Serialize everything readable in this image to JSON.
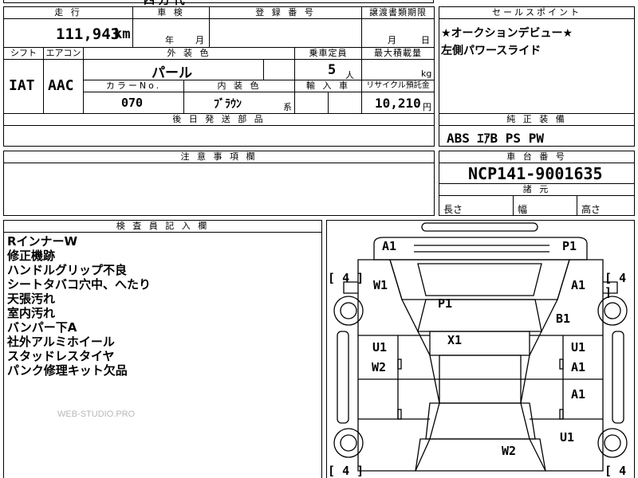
{
  "sheet": {
    "top_partial_text": "四 万 代",
    "mileage_header": "走 行",
    "mileage_value": "111,943",
    "mileage_unit": "km",
    "inspection_header": "車 検",
    "inspection_year_unit": "年",
    "inspection_month_unit": "月",
    "registration_header": "登 録 番 号",
    "transfer_header": "譲渡書類期限",
    "transfer_month_unit": "月",
    "transfer_day_unit": "日",
    "shift_header": "シフト",
    "shift_value": "IAT",
    "aircon_header": "エアコン",
    "aircon_value": "AAC",
    "exterior_header": "外 装 色",
    "exterior_value": "パール",
    "capacity_header": "乗車定員",
    "capacity_value": "5",
    "capacity_unit": "人",
    "max_load_header": "最大積載量",
    "max_load_unit": "kg",
    "color_no_header": "カラーNo.",
    "color_no_value": "070",
    "interior_header": "内 装 色",
    "interior_value": "ﾌﾞﾗｳﾝ",
    "interior_suffix": "系",
    "import_header": "輸 入 車",
    "recycle_header": "リサイクル預託金",
    "recycle_value": "10,210",
    "recycle_unit": "円",
    "later_parts_header": "後 日 発 送 部 品",
    "sales_header": "セールスポイント",
    "sales_lines": [
      "★オークションデビュー★",
      "左側パワースライド"
    ],
    "equipment_header": "純 正 装 備",
    "equipment_value": "ABS ｴｱB PS PW",
    "caution_header": "注 意 事 項 欄",
    "chassis_header": "車 台 番 号",
    "chassis_value": "NCP141-9001635",
    "dimensions_header": "諸 元",
    "length_label": "長さ",
    "width_label": "幅",
    "height_label": "高さ",
    "inspector_header": "検 査 員 記 入 欄",
    "inspector_notes": [
      "RインナーW",
      "修正機跡",
      "ハンドルグリップ不良",
      "シートタバコ穴中、へたり",
      "天張汚れ",
      "室内汚れ",
      "バンパー下A",
      "社外アルミホイール",
      "スタッドレスタイヤ",
      "パンク修理キット欠品"
    ],
    "watermark": "WEB-STUDIO.PRO"
  },
  "diagram": {
    "marks": {
      "a1_left_top": "A1",
      "p1_right_top": "P1",
      "w1_left": "W1",
      "a1_right": "A1",
      "p1_center": "P1",
      "b1_right": "B1",
      "x1_center": "X1",
      "u1_left": "U1",
      "u1_right": "U1",
      "w2_left": "W2",
      "a1_right_mid": "A1",
      "a1_right_lower": "A1",
      "u1_right_lower": "U1",
      "w2_bottom": "W2"
    },
    "tire_tl": "4",
    "tire_tr": "4",
    "tire_bl": "4",
    "tire_br": "4"
  }
}
